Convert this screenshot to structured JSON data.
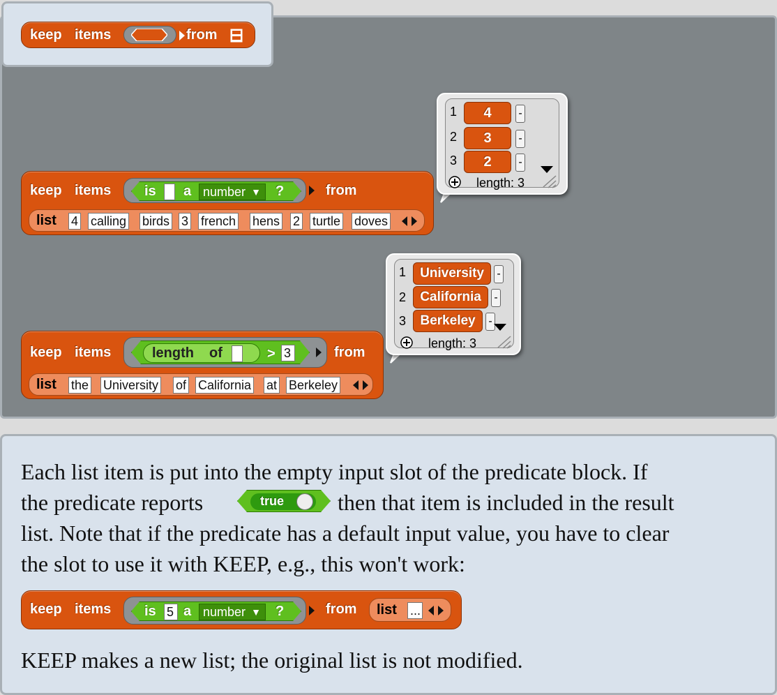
{
  "palette": {
    "block_keep": {
      "label_keep": "keep",
      "label_items": "items",
      "label_from": "from"
    },
    "list_icon": "list-icon"
  },
  "example1": {
    "keep": "keep",
    "items": "items",
    "from": "from",
    "predicate": {
      "is": "is",
      "a": "a",
      "type": "number",
      "q": "?"
    },
    "list_label": "list",
    "list_items": [
      "4",
      "calling",
      "birds",
      "3",
      "french",
      "hens",
      "2",
      "turtle",
      "doves"
    ],
    "result": {
      "rows": [
        {
          "i": "1",
          "v": "4"
        },
        {
          "i": "2",
          "v": "3"
        },
        {
          "i": "3",
          "v": "2"
        }
      ],
      "length_label": "length: 3"
    }
  },
  "example2": {
    "keep": "keep",
    "items": "items",
    "from": "from",
    "predicate": {
      "length": "length",
      "of": "of",
      "op": ">",
      "value": "3"
    },
    "list_label": "list",
    "list_items": [
      "the",
      "University",
      "of",
      "California",
      "at",
      "Berkeley"
    ],
    "result": {
      "rows": [
        {
          "i": "1",
          "v": "University"
        },
        {
          "i": "2",
          "v": "California"
        },
        {
          "i": "3",
          "v": "Berkeley"
        }
      ],
      "length_label": "length: 3"
    }
  },
  "help": {
    "para1_a": "Each list item is put into the empty input slot of the predicate block. If",
    "para1_b_pre": "the predicate reports",
    "true_label": "true",
    "para1_b_post": "then that item is included in the result",
    "para1_c": "list. Note that if the predicate has a default input value, you have to clear",
    "para1_d": "the slot to use it with KEEP, e.g., this won't work:",
    "bad_example": {
      "keep": "keep",
      "items": "items",
      "is": "is",
      "value": "5",
      "a": "a",
      "type": "number",
      "q": "?",
      "from": "from",
      "list_label": "list",
      "ellipsis": "..."
    },
    "para2": "KEEP makes a new list; the original list is not modified."
  }
}
